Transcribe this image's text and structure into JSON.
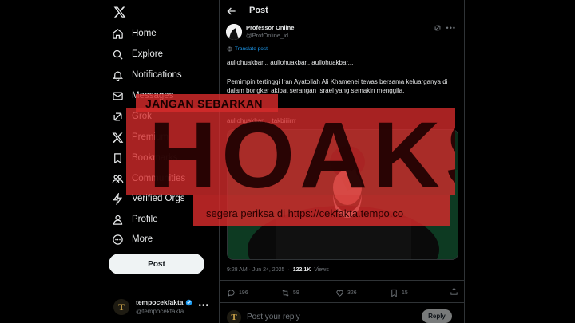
{
  "sidebar": {
    "logo_icon": "x-logo-icon",
    "items": [
      {
        "label": "Home",
        "icon": "home-icon"
      },
      {
        "label": "Explore",
        "icon": "search-icon"
      },
      {
        "label": "Notifications",
        "icon": "bell-icon"
      },
      {
        "label": "Messages",
        "icon": "mail-icon"
      },
      {
        "label": "Grok",
        "icon": "grok-icon"
      },
      {
        "label": "Premium",
        "icon": "x-logo-icon"
      },
      {
        "label": "Bookmarks",
        "icon": "bookmark-icon"
      },
      {
        "label": "Communities",
        "icon": "people-icon"
      },
      {
        "label": "Verified Orgs",
        "icon": "lightning-icon"
      },
      {
        "label": "Profile",
        "icon": "user-icon"
      },
      {
        "label": "More",
        "icon": "more-circle-icon"
      }
    ],
    "post_button": "Post",
    "account": {
      "name": "tempocekfakta",
      "handle": "@tempocekfakta",
      "avatar_letter": "T"
    }
  },
  "header": {
    "title": "Post"
  },
  "post": {
    "author_name": "Professor Online",
    "author_handle": "@ProfOnline_id",
    "translate_label": "Translate post",
    "line1": "aullohuakbar... aullohuakbar.. aullohuakbar...",
    "line2": "Pemimpin tertinggi Iran Ayatollah Ali Khamenei tewas bersama keluarganya di dalam bongker akibat serangan Israel yang semakin menggila.",
    "line3": "aullohuakbar.... takbiiiirrr",
    "time": "9:28 AM · Jun 24, 2025",
    "sep": "·",
    "views": "122.1K",
    "views_label": "Views",
    "stats": {
      "replies": "196",
      "reposts": "59",
      "likes": "326",
      "bookmarks": "15"
    }
  },
  "reply": {
    "placeholder": "Post your reply",
    "button": "Reply",
    "avatar_letter": "T"
  },
  "stamp": {
    "top_text": "JANGAN SEBARKAN",
    "main_text": "HOAKS",
    "bottom_text": "segera periksa di https://cekfakta.tempo.co",
    "color": "#d62b2b"
  }
}
